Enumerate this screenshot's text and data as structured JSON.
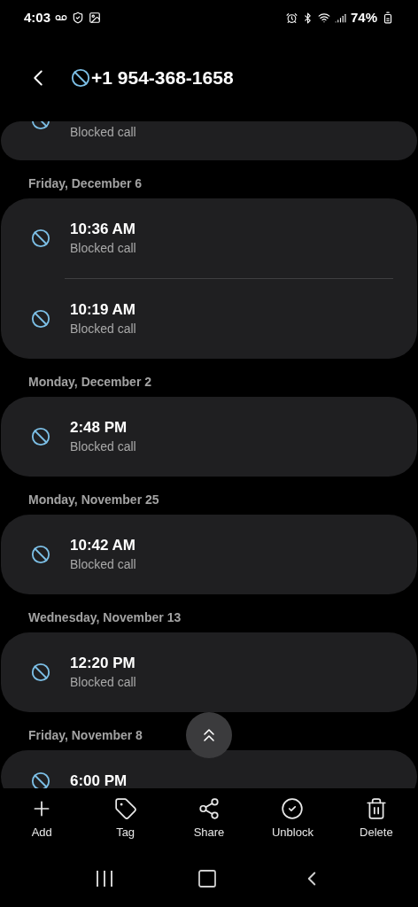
{
  "status_bar": {
    "time": "4:03",
    "battery": "74%"
  },
  "header": {
    "title": "+1 954-368-1658",
    "blocked": true
  },
  "groups": [
    {
      "calls": [
        {
          "label": "Blocked call"
        }
      ]
    },
    {
      "date": "Friday, December 6",
      "calls": [
        {
          "time": "10:36 AM",
          "label": "Blocked call"
        },
        {
          "time": "10:19 AM",
          "label": "Blocked call"
        }
      ]
    },
    {
      "date": "Monday, December 2",
      "calls": [
        {
          "time": "2:48 PM",
          "label": "Blocked call"
        }
      ]
    },
    {
      "date": "Monday, November 25",
      "calls": [
        {
          "time": "10:42 AM",
          "label": "Blocked call"
        }
      ]
    },
    {
      "date": "Wednesday, November 13",
      "calls": [
        {
          "time": "12:20 PM",
          "label": "Blocked call"
        }
      ]
    },
    {
      "date": "Friday, November 8",
      "calls": [
        {
          "time": "6:00 PM"
        }
      ]
    }
  ],
  "actions": [
    {
      "kind": "add",
      "label": "Add"
    },
    {
      "kind": "tag",
      "label": "Tag"
    },
    {
      "kind": "share",
      "label": "Share"
    },
    {
      "kind": "unblock",
      "label": "Unblock"
    },
    {
      "kind": "delete",
      "label": "Delete"
    }
  ]
}
